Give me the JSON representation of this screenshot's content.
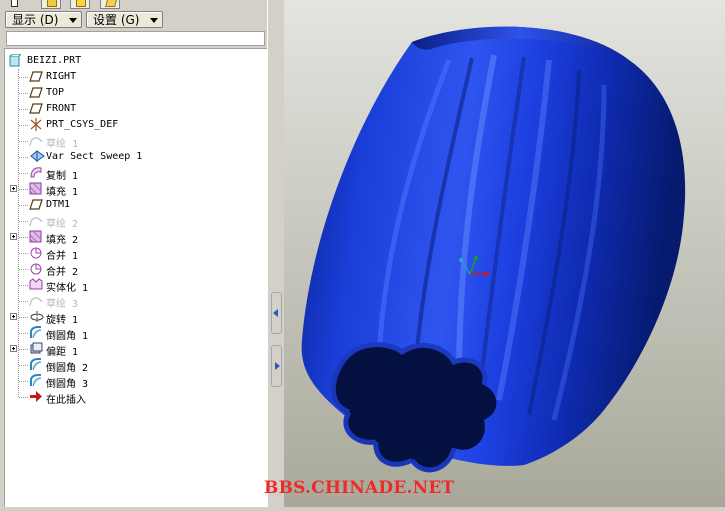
{
  "toolbar": {
    "show_label": "显示 (D)",
    "settings_label": "设置 (G)"
  },
  "model_tree": [
    {
      "label": "BEIZI.PRT",
      "icon": "part-icon",
      "root": true
    },
    {
      "label": "RIGHT",
      "icon": "datum-plane-icon"
    },
    {
      "label": "TOP",
      "icon": "datum-plane-icon"
    },
    {
      "label": "FRONT",
      "icon": "datum-plane-icon"
    },
    {
      "label": "PRT_CSYS_DEF",
      "icon": "csys-icon"
    },
    {
      "label": "草绘 1",
      "icon": "sketch-icon",
      "disabled": true
    },
    {
      "label": "Var Sect Sweep 1",
      "icon": "sweep-icon"
    },
    {
      "label": "复制 1",
      "icon": "copy-icon"
    },
    {
      "label": "填充 1",
      "icon": "fill-icon",
      "expandable": true
    },
    {
      "label": "DTM1",
      "icon": "datum-plane-icon"
    },
    {
      "label": "草绘 2",
      "icon": "sketch-icon",
      "disabled": true
    },
    {
      "label": "填充 2",
      "icon": "fill-icon",
      "expandable": true
    },
    {
      "label": "合并 1",
      "icon": "merge-icon"
    },
    {
      "label": "合并 2",
      "icon": "merge-icon"
    },
    {
      "label": "实体化 1",
      "icon": "solidify-icon"
    },
    {
      "label": "草绘 3",
      "icon": "sketch-icon",
      "disabled": true
    },
    {
      "label": "旋转 1",
      "icon": "revolve-icon",
      "expandable": true
    },
    {
      "label": "倒圆角 1",
      "icon": "round-icon"
    },
    {
      "label": "偏距 1",
      "icon": "offset-icon",
      "expandable": true
    },
    {
      "label": "倒圆角 2",
      "icon": "round-icon"
    },
    {
      "label": "倒圆角 3",
      "icon": "round-icon"
    },
    {
      "label": "在此插入",
      "icon": "insert-here-arrow-icon"
    }
  ],
  "viewport": {
    "background_top": "#e4e4e0",
    "background_bottom": "#a8a89a",
    "model_color": "#1d3fd8",
    "model_dark": "#051a66"
  },
  "watermark": "BBS.CHINADE.NET"
}
